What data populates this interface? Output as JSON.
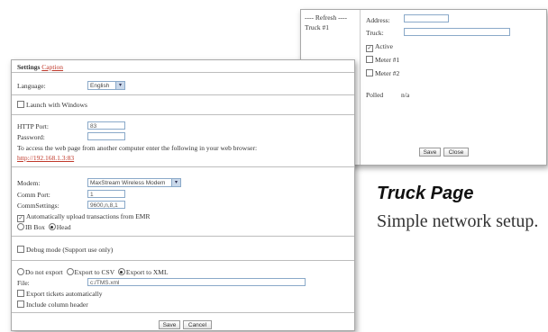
{
  "truck_page": {
    "list_header": "---- Refresh ----",
    "list_items": [
      "Truck #1"
    ],
    "address_label": "Address:",
    "address_value": "",
    "truck_label": "Truck:",
    "truck_value": "",
    "active_label": "Active",
    "active_checked": true,
    "meter1_label": "Meter #1",
    "meter1_checked": false,
    "meter2_label": "Meter #2",
    "meter2_checked": false,
    "polled_label": "Polled",
    "polled_value": "n/a",
    "save_label": "Save",
    "close_label": "Close"
  },
  "settings": {
    "title": "Settings",
    "caption_link": "Caption",
    "language_label": "Language:",
    "language_value": "English",
    "launch_label": "Launch with Windows",
    "launch_checked": false,
    "http_port_label": "HTTP Port:",
    "http_port_value": "83",
    "password_label": "Password:",
    "password_value": "",
    "access_text": "To access the web page from another computer enter the following in your web browser:",
    "access_url": "http://192.168.1.3:83",
    "modem_label": "Modem:",
    "modem_value": "MaxStream Wireless Modem",
    "comm_port_label": "Comm Port:",
    "comm_port_value": "1",
    "comm_settings_label": "CommSettings:",
    "comm_settings_value": "9600,n,8,1",
    "auto_upload_label": "Automatically upload transactions from EMR",
    "auto_upload_checked": true,
    "ib_box_label": "IB Box",
    "head_label": "Head",
    "head_selected": true,
    "debug_label": "Debug mode (Support use only)",
    "debug_checked": false,
    "no_export_label": "Do not export",
    "export_csv_label": "Export to CSV",
    "export_xml_label": "Export to XML",
    "export_xml_selected": true,
    "file_label": "File:",
    "file_value": "c:/TMS.xml",
    "export_auto_label": "Export tickets automatically",
    "include_header_label": "Include column header",
    "save_label": "Save",
    "cancel_label": "Cancel"
  },
  "caption": {
    "title": "Truck Page",
    "text": "Simple network setup."
  }
}
